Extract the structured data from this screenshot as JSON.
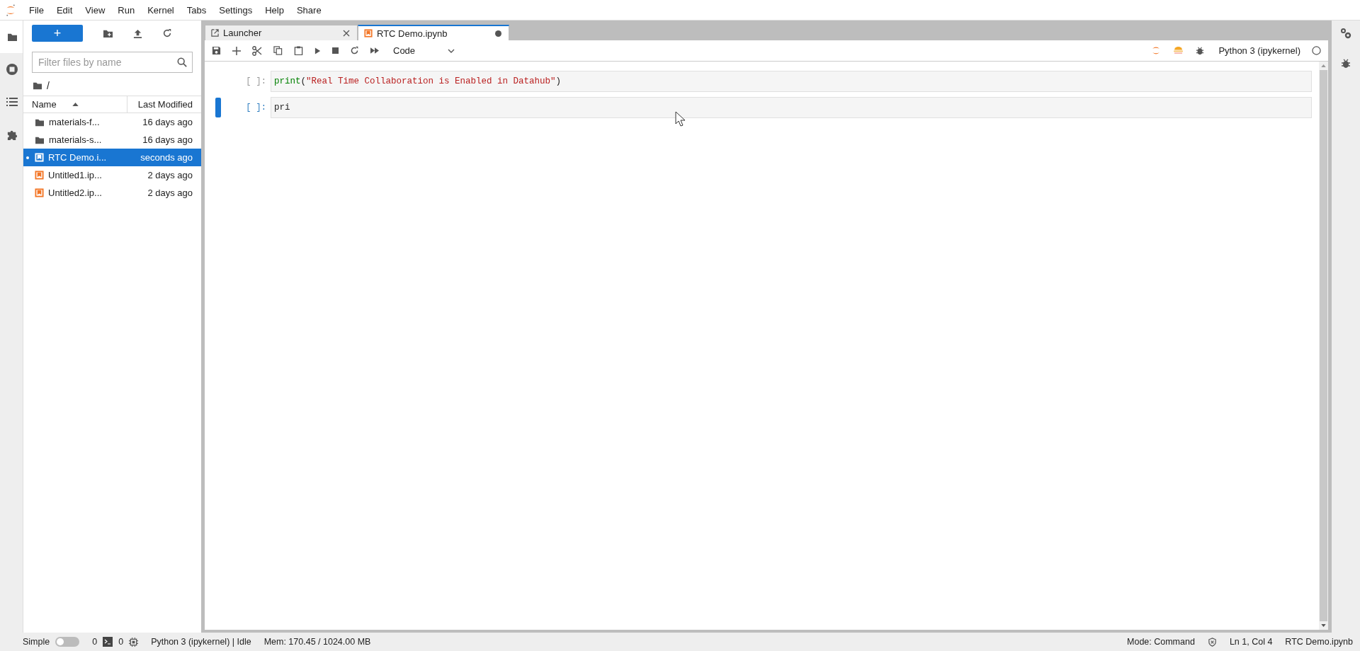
{
  "menu": [
    "File",
    "Edit",
    "View",
    "Run",
    "Kernel",
    "Tabs",
    "Settings",
    "Help",
    "Share"
  ],
  "left_bar": [
    {
      "kind": "folder",
      "selected": true
    },
    {
      "kind": "stop",
      "selected": false
    },
    {
      "kind": "list",
      "selected": false
    },
    {
      "kind": "puzzle",
      "selected": false
    }
  ],
  "file_browser": {
    "new_label": "+",
    "filter_placeholder": "Filter files by name",
    "path": "/",
    "columns": [
      {
        "label": "Name",
        "sorted": true
      },
      {
        "label": "Last Modified",
        "sorted": false
      }
    ],
    "files": [
      {
        "kind": "folder",
        "name": "materials-f...",
        "modified": "16 days ago",
        "selected": false,
        "running": false
      },
      {
        "kind": "folder",
        "name": "materials-s...",
        "modified": "16 days ago",
        "selected": false,
        "running": false
      },
      {
        "kind": "notebook",
        "name": "RTC Demo.i...",
        "modified": "seconds ago",
        "selected": true,
        "running": true
      },
      {
        "kind": "notebook",
        "name": "Untitled1.ip...",
        "modified": "2 days ago",
        "selected": false,
        "running": false
      },
      {
        "kind": "notebook",
        "name": "Untitled2.ip...",
        "modified": "2 days ago",
        "selected": false,
        "running": false
      }
    ]
  },
  "tabs": [
    {
      "kind": "launcher",
      "label": "Launcher",
      "selected": false,
      "dirty": false
    },
    {
      "kind": "notebook",
      "label": "RTC Demo.ipynb",
      "selected": true,
      "dirty": true
    }
  ],
  "toolbar": {
    "cell_type": "Code",
    "kernel": "Python 3 (ipykernel)",
    "kernel_busy": false
  },
  "cells": [
    {
      "prompt": "[ ]:",
      "code": [
        {
          "kind": "builtin",
          "text": "print"
        },
        {
          "kind": "plain",
          "text": "("
        },
        {
          "kind": "string",
          "text": "\"Real Time Collaboration is Enabled in Datahub\""
        },
        {
          "kind": "plain",
          "text": ")"
        }
      ],
      "active": false
    },
    {
      "prompt": "[ ]:",
      "code": [
        {
          "kind": "plain",
          "text": "pri"
        }
      ],
      "active": true
    }
  ],
  "status_bar": {
    "mode_label": "Simple",
    "simple_on": false,
    "terminals": "0",
    "kernels": "0",
    "kernel_status": "Python 3 (ipykernel) | Idle",
    "memory": "Mem: 170.45 / 1024.00 MB",
    "mode": "Mode: Command",
    "position": "Ln 1, Col 4",
    "file": "RTC Demo.ipynb"
  }
}
